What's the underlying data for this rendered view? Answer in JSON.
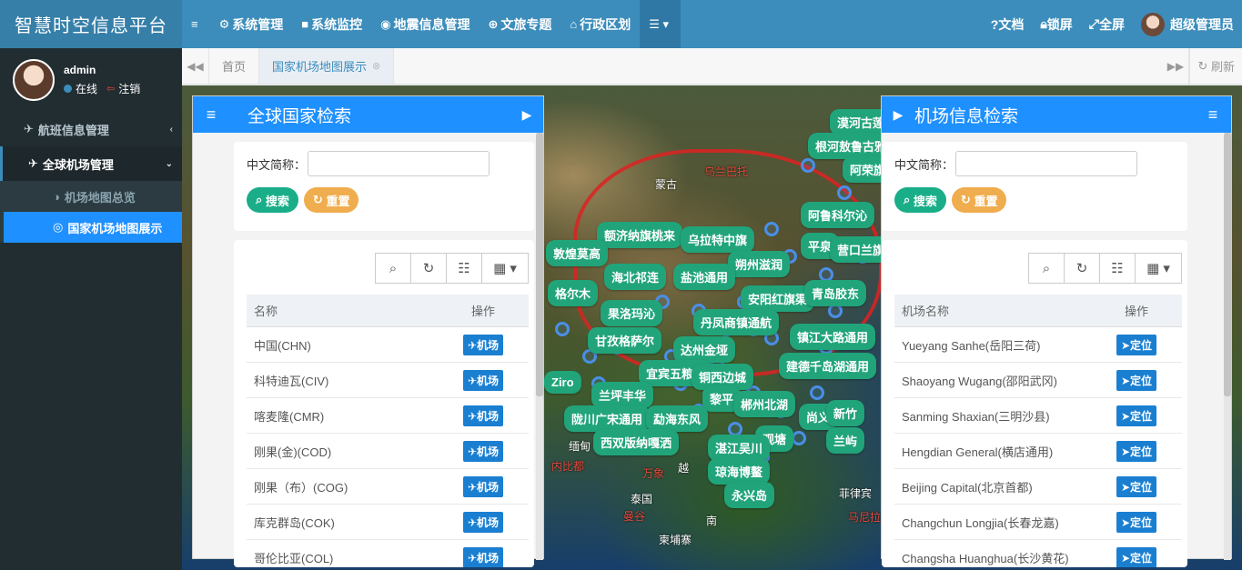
{
  "brand": "智慧时空信息平台",
  "topnav": [
    {
      "icon": "≡",
      "label": "",
      "name": "hamburger"
    },
    {
      "icon": "⚙",
      "label": "系统管理",
      "name": "system-manage"
    },
    {
      "icon": "■",
      "label": "系统监控",
      "name": "system-monitor"
    },
    {
      "icon": "◉",
      "label": "地震信息管理",
      "name": "earthquake-info"
    },
    {
      "icon": "⊕",
      "label": "文旅专题",
      "name": "culture-tourism"
    },
    {
      "icon": "⌂",
      "label": "行政区划",
      "name": "admin-division"
    },
    {
      "icon": "☰ ▾",
      "label": "",
      "name": "more-menu"
    }
  ],
  "topright": {
    "docs": "文档",
    "lock": "锁屏",
    "fullscreen": "全屏",
    "user": "超级管理员"
  },
  "sidebar": {
    "username": "admin",
    "online": "在线",
    "logout": "注销",
    "items": [
      {
        "label": "航班信息管理",
        "icon": "✈"
      },
      {
        "label": "全球机场管理",
        "icon": "✈"
      }
    ],
    "subitems": [
      {
        "label": "机场地图总览",
        "icon": "◑"
      },
      {
        "label": "国家机场地图展示",
        "icon": "◎"
      }
    ]
  },
  "tabs": {
    "home": "首页",
    "active": "国家机场地图展示",
    "refresh": "刷新"
  },
  "map": {
    "labels": [
      "乌兰巴托",
      "蒙古",
      "缅甸",
      "泰国",
      "越",
      "南",
      "柬埔寨",
      "菲律宾",
      "马尼拉",
      "万象",
      "曼谷",
      "内比都"
    ],
    "airports": [
      "漠河古莲",
      "根河敖鲁古雅",
      "阿荣旗",
      "阿鲁科尔沁",
      "额济纳旗桃来",
      "乌拉特中旗",
      "敦煌莫高",
      "朔州滋润",
      "平泉",
      "营口兰旗",
      "海北祁连",
      "盐池通用",
      "格尔木",
      "安阳红旗渠",
      "青岛胶东",
      "果洛玛沁",
      "丹凤商镇通航",
      "镇江大路通用",
      "甘孜格萨尔",
      "达州金垭",
      "建德千岛湖通用",
      "Ziro",
      "宜宾五粮液",
      "铜西边城",
      "兰坪丰华",
      "黎平",
      "郴州北湖",
      "尚义",
      "新竹",
      "陇川广宋通用",
      "勐海东风",
      "观塘",
      "西双版纳嘎洒",
      "湛江吴川",
      "兰屿",
      "琼海博鳌",
      "永兴岛"
    ]
  },
  "left_panel": {
    "title": "全球国家检索",
    "field_label": "中文简称：",
    "search": "搜索",
    "reset": "重置",
    "col_name": "名称",
    "col_op": "操作",
    "op_label": "机场",
    "rows": [
      "中国(CHN)",
      "科特迪瓦(CIV)",
      "喀麦隆(CMR)",
      "刚果(金)(COD)",
      "刚果（布）(COG)",
      "库克群岛(COK)",
      "哥伦比亚(COL)"
    ]
  },
  "right_panel": {
    "title": "机场信息检索",
    "field_label": "中文简称：",
    "search": "搜索",
    "reset": "重置",
    "col_name": "机场名称",
    "col_op": "操作",
    "op_label": "定位",
    "rows": [
      "Yueyang Sanhe(岳阳三荷)",
      "Shaoyang Wugang(邵阳武冈)",
      "Sanming Shaxian(三明沙县)",
      "Hengdian General(横店通用)",
      "Beijing Capital(北京首都)",
      "Changchun Longjia(长春龙嘉)",
      "Changsha Huanghua(长沙黄花)"
    ]
  }
}
